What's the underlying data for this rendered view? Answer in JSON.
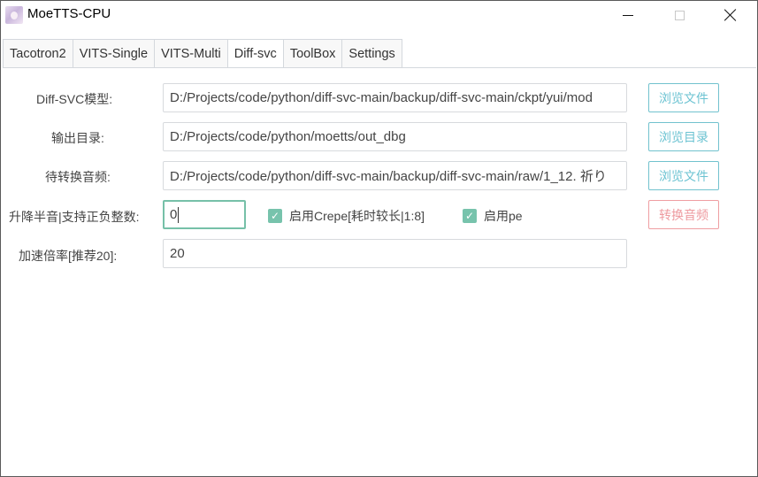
{
  "window": {
    "title": "MoeTTS-CPU",
    "icon": "app-avatar-icon",
    "controls": {
      "minimize": "minimize-icon",
      "maximize": "maximize-icon",
      "close": "close-icon"
    }
  },
  "tabs": [
    {
      "label": "Tacotron2",
      "active": false
    },
    {
      "label": "VITS-Single",
      "active": false
    },
    {
      "label": "VITS-Multi",
      "active": false
    },
    {
      "label": "Diff-svc",
      "active": true
    },
    {
      "label": "ToolBox",
      "active": false
    },
    {
      "label": "Settings",
      "active": false
    }
  ],
  "form": {
    "model": {
      "label": "Diff-SVC模型:",
      "value": "D:/Projects/code/python/diff-svc-main/backup/diff-svc-main/ckpt/yui/mod",
      "button": "浏览文件"
    },
    "output_dir": {
      "label": "输出目录:",
      "value": "D:/Projects/code/python/moetts/out_dbg",
      "button": "浏览目录"
    },
    "input_audio": {
      "label": "待转换音频:",
      "value": "D:/Projects/code/python/diff-svc-main/backup/diff-svc-main/raw/1_12. 祈り",
      "button": "浏览文件"
    },
    "pitch_shift": {
      "label": "升降半音|支持正负整数:",
      "value": "0"
    },
    "use_crepe": {
      "label": "启用Crepe[耗时较长|1:8]",
      "checked": true
    },
    "use_pe": {
      "label": "启用pe",
      "checked": true
    },
    "convert_button": "转换音频",
    "speedup": {
      "label": "加速倍率[推荐20]:",
      "value": "20"
    }
  },
  "colors": {
    "accent_teal": "#6cc3d2",
    "accent_green": "#77c3ac",
    "accent_red": "#ee9a9f"
  }
}
